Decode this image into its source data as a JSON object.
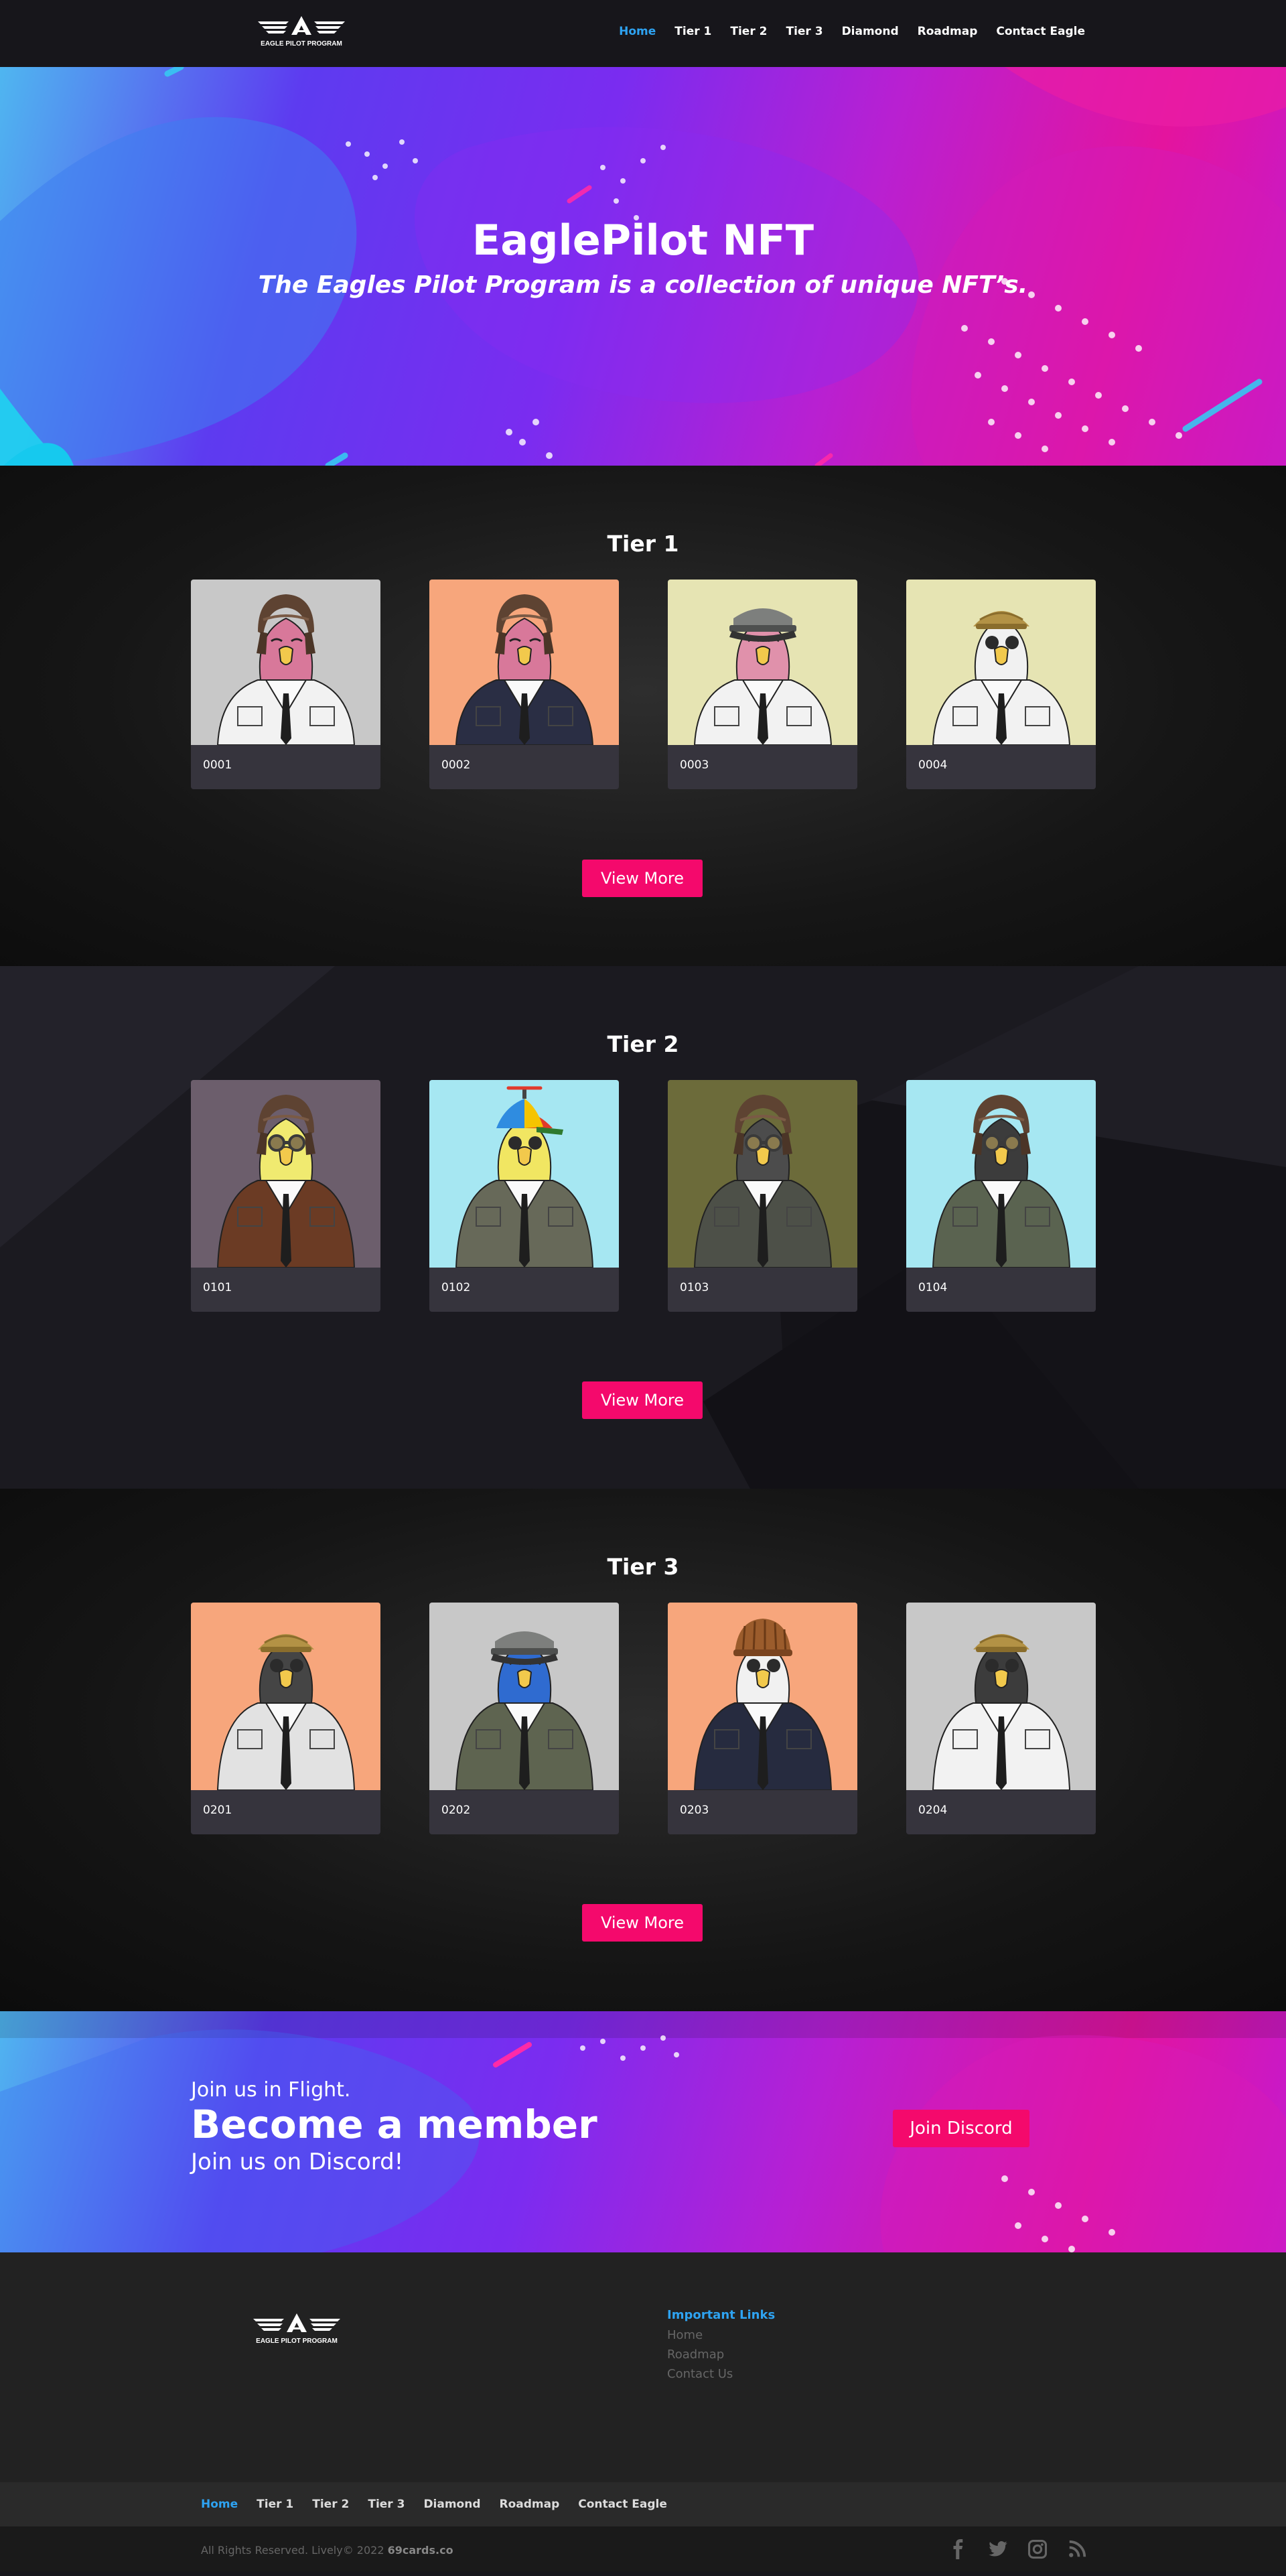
{
  "header": {
    "logo_text": "EAGLE PILOT PROGRAM",
    "nav": [
      {
        "label": "Home",
        "active": true
      },
      {
        "label": "Tier 1"
      },
      {
        "label": "Tier 2"
      },
      {
        "label": "Tier 3"
      },
      {
        "label": "Diamond"
      },
      {
        "label": "Roadmap"
      },
      {
        "label": "Contact Eagle"
      }
    ]
  },
  "hero": {
    "title": "EaglePilot NFT",
    "subtitle": "The Eagles Pilot Program is a collection of unique NFT’s."
  },
  "tiers": [
    {
      "title": "Tier 1",
      "cards": [
        {
          "id": "0001",
          "bg": "#c8c8c8",
          "head": "#d8789a",
          "hat": "cap-brown",
          "jacket": "#f2f2f2"
        },
        {
          "id": "0002",
          "bg": "#f7a67c",
          "head": "#d8789a",
          "hat": "cap-brown",
          "jacket": "#2a2e44"
        },
        {
          "id": "0003",
          "bg": "#e6e4b3",
          "head": "#e091ab",
          "hat": "cap-grey",
          "jacket": "#f2f2f2"
        },
        {
          "id": "0004",
          "bg": "#e6e4b3",
          "head": "#f1f1f1",
          "hat": "cap-gold",
          "jacket": "#f2f2f2"
        }
      ],
      "button": "View More"
    },
    {
      "title": "Tier 2",
      "cards": [
        {
          "id": "0101",
          "bg": "#6c5e6c",
          "head": "#f0ea70",
          "hat": "cap-brown",
          "jacket": "#6b3b24"
        },
        {
          "id": "0102",
          "bg": "#a6e7f2",
          "head": "#f1e662",
          "hat": "propeller",
          "jacket": "#676959"
        },
        {
          "id": "0103",
          "bg": "#6c6b3a",
          "head": "#4c4c4c",
          "hat": "cap-brown",
          "jacket": "#4d5048"
        },
        {
          "id": "0104",
          "bg": "#a6e7f2",
          "head": "#3c3c3c",
          "hat": "cap-brown",
          "jacket": "#5a6350"
        }
      ],
      "button": "View More"
    },
    {
      "title": "Tier 3",
      "cards": [
        {
          "id": "0201",
          "bg": "#f7a67c",
          "head": "#454545",
          "hat": "cap-gold",
          "jacket": "#e2e2e2"
        },
        {
          "id": "0202",
          "bg": "#c8c8c8",
          "head": "#2f6bd0",
          "hat": "cap-grey",
          "jacket": "#5e6450"
        },
        {
          "id": "0203",
          "bg": "#f7a67c",
          "head": "#f1f1f1",
          "hat": "beanie",
          "jacket": "#262b3f"
        },
        {
          "id": "0204",
          "bg": "#c8c8c8",
          "head": "#3c3c3c",
          "hat": "cap-gold",
          "jacket": "#f2f2f2"
        }
      ],
      "button": "View More"
    }
  ],
  "member": {
    "pre": "Join us in Flight.",
    "title": "Become a member",
    "post": "Join us on Discord!",
    "button": "Join Discord"
  },
  "footer": {
    "logo_text": "EAGLE PILOT PROGRAM",
    "links_heading": "Important Links",
    "links": [
      "Home",
      "Roadmap",
      "Contact Us"
    ],
    "nav": [
      {
        "label": "Home",
        "active": true
      },
      {
        "label": "Tier 1"
      },
      {
        "label": "Tier 2"
      },
      {
        "label": "Tier 3"
      },
      {
        "label": "Diamond"
      },
      {
        "label": "Roadmap"
      },
      {
        "label": "Contact Eagle"
      }
    ],
    "copyright_prefix": "All Rights Reserved. Lively© 2022 ",
    "copyright_brand": "69cards.co",
    "social": [
      "facebook-icon",
      "twitter-icon",
      "instagram-icon",
      "rss-icon"
    ]
  },
  "colors": {
    "accent": "#f4096c",
    "link_active": "#2ea3f2"
  }
}
